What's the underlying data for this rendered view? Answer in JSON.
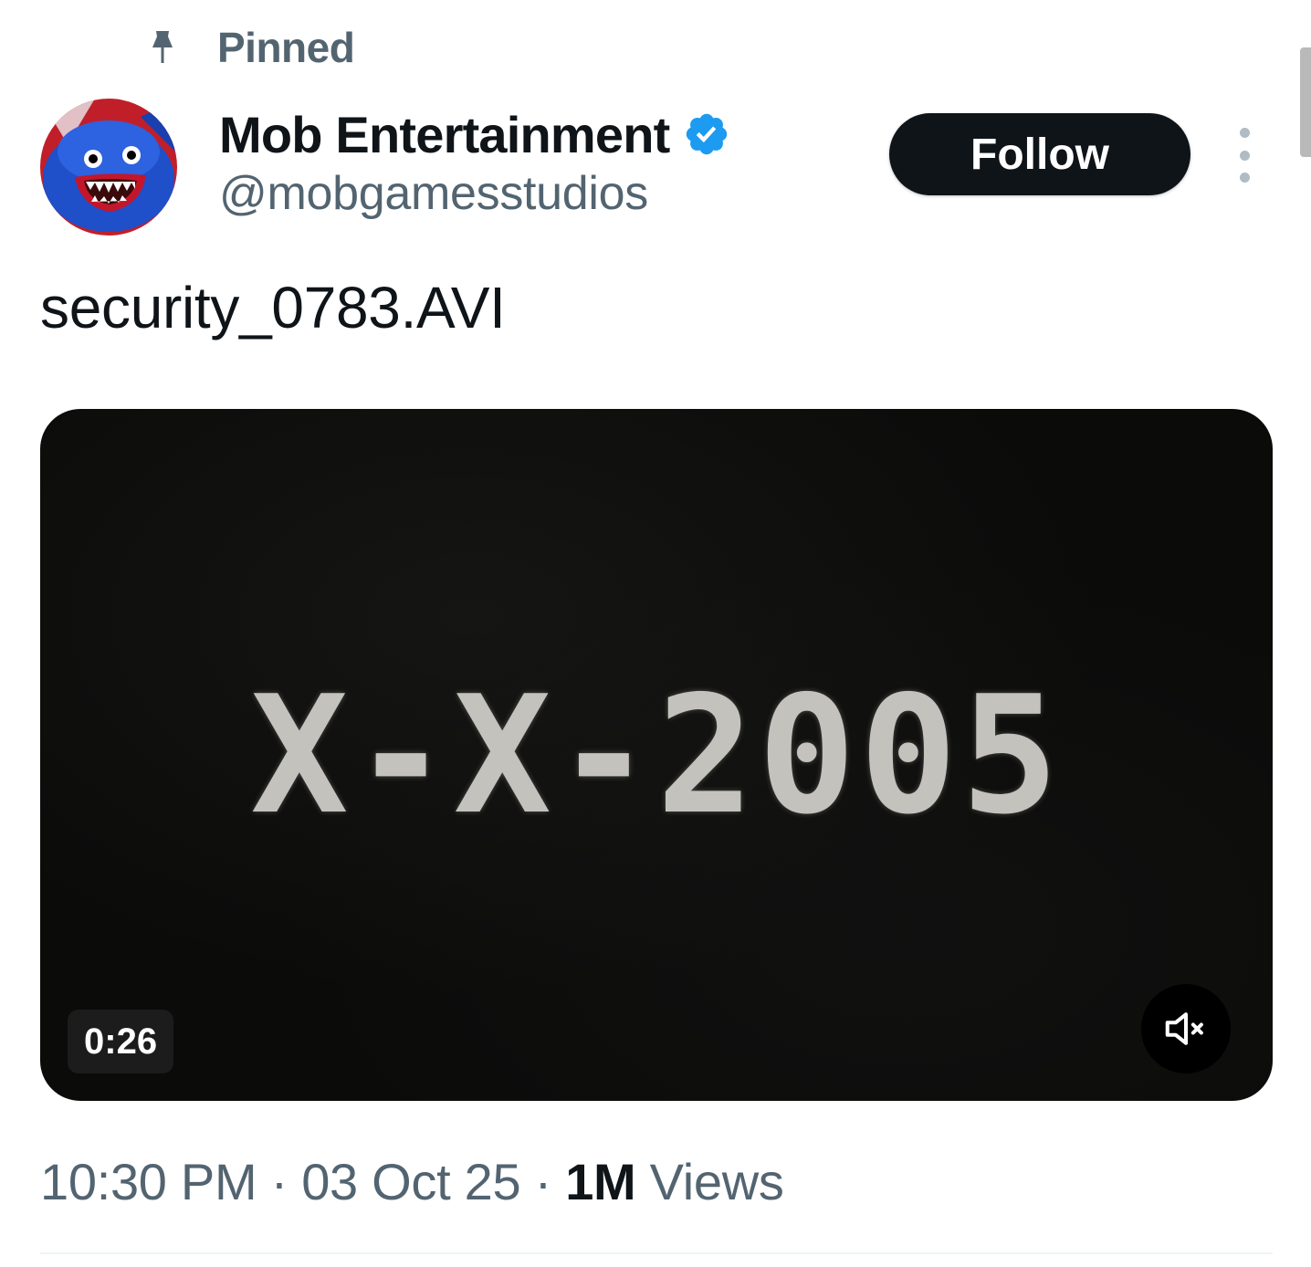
{
  "pinned": {
    "icon": "pin-icon",
    "label": "Pinned"
  },
  "author": {
    "display_name": "Mob Entertainment",
    "handle": "@mobgamesstudios",
    "verified_icon": "verified-badge-icon",
    "verified_color": "#1d9bf0"
  },
  "actions": {
    "follow_label": "Follow",
    "more_icon": "more-options-icon"
  },
  "tweet": {
    "text": "security_0783.AVI"
  },
  "video": {
    "frame_text": "X-X-2005",
    "duration": "0:26",
    "mute_icon": "muted-speaker-icon"
  },
  "meta": {
    "time": "10:30 PM",
    "separator": "·",
    "date": "03 Oct 25",
    "views_count": "1M",
    "views_label": "Views"
  },
  "colors": {
    "text_primary": "#0f1419",
    "text_secondary": "#536471",
    "button_dark": "#0f1419"
  }
}
